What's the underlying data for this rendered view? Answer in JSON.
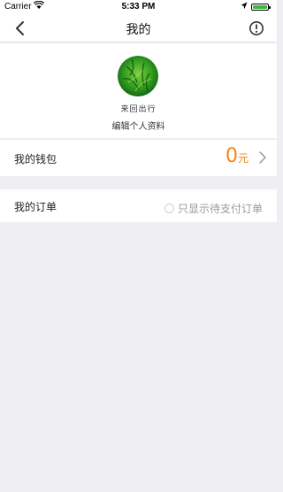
{
  "status_bar": {
    "carrier": "Carrier",
    "time": "5:33 PM",
    "battery_color": "#3cba40"
  },
  "nav": {
    "title": "我的",
    "back_icon": "chevron-left-icon",
    "info_icon": "exclamation-circle-icon"
  },
  "profile": {
    "nickname": "来回出行",
    "edit_label": "编辑个人资料"
  },
  "wallet": {
    "label": "我的钱包",
    "amount": "0",
    "unit": "元"
  },
  "orders": {
    "label": "我的订单",
    "filter_label": "只显示待支付订单",
    "filter_checked": false
  },
  "colors": {
    "accent": "#f08519",
    "background": "#eeeef3"
  }
}
